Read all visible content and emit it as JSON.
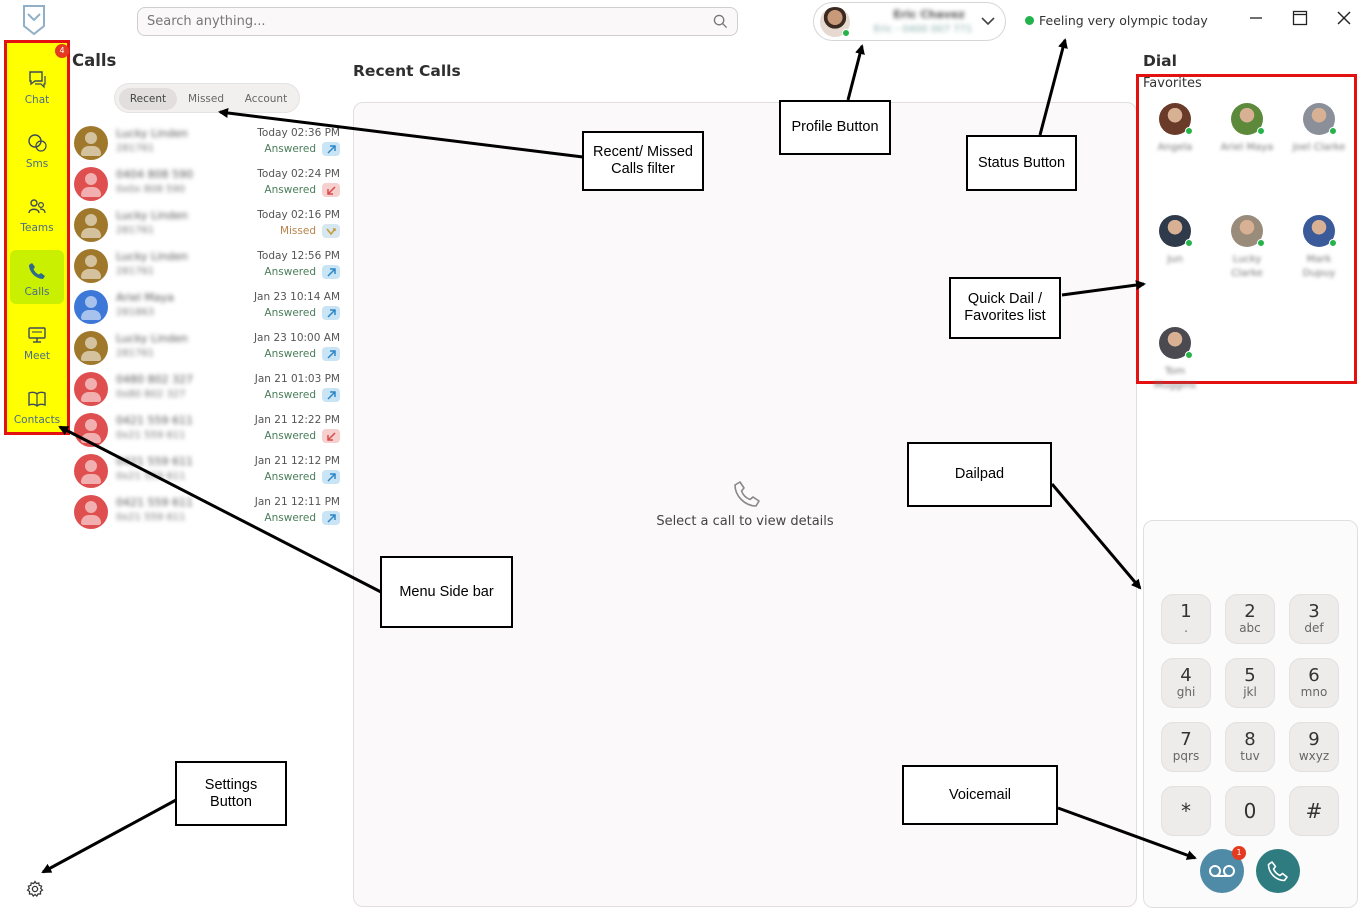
{
  "search": {
    "placeholder": "Search anything..."
  },
  "profile": {
    "name": "Eric Chavez",
    "number": "Eric - 0400 007 771"
  },
  "status": {
    "text": "Feeling very olympic today",
    "color": "#21b24b"
  },
  "sidebar": {
    "badge": "4",
    "items": [
      {
        "label": "Chat",
        "icon": "chat-icon"
      },
      {
        "label": "Sms",
        "icon": "sms-icon"
      },
      {
        "label": "Teams",
        "icon": "teams-icon"
      },
      {
        "label": "Calls",
        "icon": "phone-icon",
        "active": true
      },
      {
        "label": "Meet",
        "icon": "meet-icon"
      },
      {
        "label": "Contacts",
        "icon": "contacts-icon"
      }
    ]
  },
  "calls": {
    "title": "Calls",
    "filters": [
      "Recent",
      "Missed",
      "Account"
    ],
    "rows": [
      {
        "name": "Lucky Linden",
        "number": "281761",
        "time": "Today 02:36 PM",
        "status": "Answered",
        "direction": "out",
        "color": "#a0782c"
      },
      {
        "name": "0404 808 590",
        "number": "0x0x 808 590",
        "time": "Today 02:24 PM",
        "status": "Answered",
        "direction": "in",
        "color": "#df4f4f"
      },
      {
        "name": "Lucky Linden",
        "number": "281761",
        "time": "Today 02:16 PM",
        "status": "Missed",
        "direction": "missed",
        "color": "#a0782c"
      },
      {
        "name": "Lucky Linden",
        "number": "281761",
        "time": "Today 12:56 PM",
        "status": "Answered",
        "direction": "out",
        "color": "#a0782c"
      },
      {
        "name": "Ariel Maya",
        "number": "281863",
        "time": "Jan 23 10:14 AM",
        "status": "Answered",
        "direction": "out",
        "color": "#3d78d8"
      },
      {
        "name": "Lucky Linden",
        "number": "281761",
        "time": "Jan 23 10:00 AM",
        "status": "Answered",
        "direction": "out",
        "color": "#a0782c"
      },
      {
        "name": "0480 802 327",
        "number": "0x80 802 327",
        "time": "Jan 21 01:03 PM",
        "status": "Answered",
        "direction": "out",
        "color": "#df4f4f"
      },
      {
        "name": "0421 559 611",
        "number": "0x21 559 611",
        "time": "Jan 21 12:22 PM",
        "status": "Answered",
        "direction": "in",
        "color": "#df4f4f"
      },
      {
        "name": "0421 559 611",
        "number": "0x21 559 611",
        "time": "Jan 21 12:12 PM",
        "status": "Answered",
        "direction": "out",
        "color": "#df4f4f"
      },
      {
        "name": "0421 559 611",
        "number": "0x21 559 611",
        "time": "Jan 21 12:11 PM",
        "status": "Answered",
        "direction": "out",
        "color": "#df4f4f"
      }
    ]
  },
  "recent": {
    "title": "Recent Calls",
    "empty_text": "Select a call to view details"
  },
  "dial": {
    "title": "Dial",
    "favorites_title": "Favorites",
    "favorites": [
      {
        "name": "Angela",
        "color": "#6b3b2a"
      },
      {
        "name": "Ariel Maya",
        "color": "#5c8a3a"
      },
      {
        "name": "Joel Clarke",
        "color": "#8a8f9a"
      },
      {
        "name": "Jun",
        "color": "#2f3a4a"
      },
      {
        "name": "Lucky Clarke",
        "color": "#9a8c7a"
      },
      {
        "name": "Mark Dupuy",
        "color": "#3a5a9a"
      },
      {
        "name": "Tom Muggins",
        "color": "#4a4a50"
      }
    ],
    "keys": [
      {
        "digit": "1",
        "letters": "."
      },
      {
        "digit": "2",
        "letters": "abc"
      },
      {
        "digit": "3",
        "letters": "def"
      },
      {
        "digit": "4",
        "letters": "ghi"
      },
      {
        "digit": "5",
        "letters": "jkl"
      },
      {
        "digit": "6",
        "letters": "mno"
      },
      {
        "digit": "7",
        "letters": "pqrs"
      },
      {
        "digit": "8",
        "letters": "tuv"
      },
      {
        "digit": "9",
        "letters": "wxyz"
      },
      {
        "digit": "*",
        "letters": ""
      },
      {
        "digit": "0",
        "letters": ""
      },
      {
        "digit": "#",
        "letters": ""
      }
    ],
    "voicemail_badge": "1"
  },
  "annotations": {
    "filter": "Recent/ Missed\nCalls filter",
    "profile": "Profile Button",
    "status": "Status Button",
    "favorites": "Quick Dail /\nFavorites list",
    "dialpad": "Dailpad",
    "sidebar": "Menu Side bar",
    "settings": "Settings\nButton",
    "voicemail": "Voicemail"
  }
}
